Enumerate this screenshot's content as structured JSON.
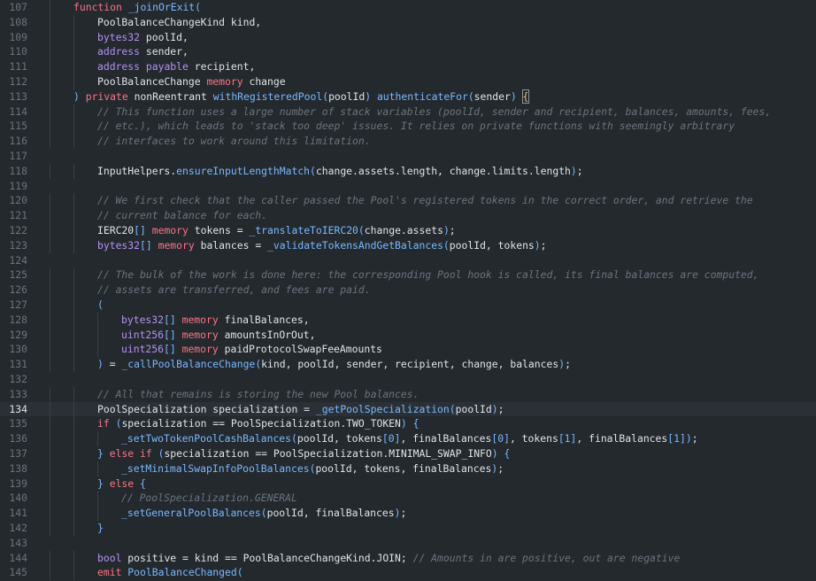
{
  "editor": {
    "current_line": 134,
    "colors": {
      "background": "#24292e",
      "keyword": "#f97583",
      "type": "#b392f0",
      "function": "#79b8ff",
      "comment": "#6a737d",
      "text": "#e1e4e8"
    },
    "lines": [
      {
        "n": 107,
        "indent": 1,
        "parts": [
          [
            "kw",
            "function"
          ],
          [
            "pr",
            " "
          ],
          [
            "fn",
            "_joinOrExit"
          ],
          [
            "pb",
            "("
          ]
        ]
      },
      {
        "n": 108,
        "indent": 2,
        "parts": [
          [
            "ty",
            "PoolBalanceChangeKind"
          ],
          [
            "pr",
            " kind,"
          ]
        ]
      },
      {
        "n": 109,
        "indent": 2,
        "parts": [
          [
            "tk",
            "bytes32"
          ],
          [
            "pr",
            " poolId,"
          ]
        ]
      },
      {
        "n": 110,
        "indent": 2,
        "parts": [
          [
            "tk",
            "address"
          ],
          [
            "pr",
            " sender,"
          ]
        ]
      },
      {
        "n": 111,
        "indent": 2,
        "parts": [
          [
            "tk",
            "address"
          ],
          [
            "pr",
            " "
          ],
          [
            "tk",
            "payable"
          ],
          [
            "pr",
            " recipient,"
          ]
        ]
      },
      {
        "n": 112,
        "indent": 2,
        "parts": [
          [
            "ty",
            "PoolBalanceChange"
          ],
          [
            "pr",
            " "
          ],
          [
            "kw",
            "memory"
          ],
          [
            "pr",
            " change"
          ]
        ]
      },
      {
        "n": 113,
        "indent": 1,
        "parts": [
          [
            "pb",
            ")"
          ],
          [
            "pr",
            " "
          ],
          [
            "kw",
            "private"
          ],
          [
            "pr",
            " nonReentrant "
          ],
          [
            "fnc",
            "withRegisteredPool"
          ],
          [
            "pb",
            "("
          ],
          [
            "pr",
            "poolId"
          ],
          [
            "pb",
            ")"
          ],
          [
            "pr",
            " "
          ],
          [
            "fnc",
            "authenticateFor"
          ],
          [
            "pb",
            "("
          ],
          [
            "pr",
            "sender"
          ],
          [
            "pb",
            ")"
          ],
          [
            "pr",
            " "
          ],
          [
            "bm",
            "{"
          ]
        ]
      },
      {
        "n": 114,
        "indent": 2,
        "parts": [
          [
            "cm",
            "// This function uses a large number of stack variables (poolId, sender and recipient, balances, amounts, fees,"
          ]
        ]
      },
      {
        "n": 115,
        "indent": 2,
        "parts": [
          [
            "cm",
            "// etc.), which leads to 'stack too deep' issues. It relies on private functions with seemingly arbitrary"
          ]
        ]
      },
      {
        "n": 116,
        "indent": 2,
        "parts": [
          [
            "cm",
            "// interfaces to work around this limitation."
          ]
        ]
      },
      {
        "n": 117,
        "indent": 0,
        "parts": []
      },
      {
        "n": 118,
        "indent": 2,
        "parts": [
          [
            "pr",
            "InputHelpers."
          ],
          [
            "fnc",
            "ensureInputLengthMatch"
          ],
          [
            "pb",
            "("
          ],
          [
            "pr",
            "change.assets.length, change.limits.length"
          ],
          [
            "pb",
            ")"
          ],
          [
            "pr",
            ";"
          ]
        ]
      },
      {
        "n": 119,
        "indent": 0,
        "parts": []
      },
      {
        "n": 120,
        "indent": 2,
        "parts": [
          [
            "cm",
            "// We first check that the caller passed the Pool's registered tokens in the correct order, and retrieve the"
          ]
        ]
      },
      {
        "n": 121,
        "indent": 2,
        "parts": [
          [
            "cm",
            "// current balance for each."
          ]
        ]
      },
      {
        "n": 122,
        "indent": 2,
        "parts": [
          [
            "pr",
            "IERC20"
          ],
          [
            "pb",
            "[]"
          ],
          [
            "pr",
            " "
          ],
          [
            "kw",
            "memory"
          ],
          [
            "pr",
            " tokens = "
          ],
          [
            "fnc",
            "_translateToIERC20"
          ],
          [
            "pb",
            "("
          ],
          [
            "pr",
            "change.assets"
          ],
          [
            "pb",
            ")"
          ],
          [
            "pr",
            ";"
          ]
        ]
      },
      {
        "n": 123,
        "indent": 2,
        "parts": [
          [
            "tk",
            "bytes32"
          ],
          [
            "pb",
            "[]"
          ],
          [
            "pr",
            " "
          ],
          [
            "kw",
            "memory"
          ],
          [
            "pr",
            " balances = "
          ],
          [
            "fnc",
            "_validateTokensAndGetBalances"
          ],
          [
            "pb",
            "("
          ],
          [
            "pr",
            "poolId, tokens"
          ],
          [
            "pb",
            ")"
          ],
          [
            "pr",
            ";"
          ]
        ]
      },
      {
        "n": 124,
        "indent": 0,
        "parts": []
      },
      {
        "n": 125,
        "indent": 2,
        "parts": [
          [
            "cm",
            "// The bulk of the work is done here: the corresponding Pool hook is called, its final balances are computed,"
          ]
        ]
      },
      {
        "n": 126,
        "indent": 2,
        "parts": [
          [
            "cm",
            "// assets are transferred, and fees are paid."
          ]
        ]
      },
      {
        "n": 127,
        "indent": 2,
        "parts": [
          [
            "pb",
            "("
          ]
        ]
      },
      {
        "n": 128,
        "indent": 3,
        "parts": [
          [
            "tk",
            "bytes32"
          ],
          [
            "pb",
            "[]"
          ],
          [
            "pr",
            " "
          ],
          [
            "kw",
            "memory"
          ],
          [
            "pr",
            " finalBalances,"
          ]
        ]
      },
      {
        "n": 129,
        "indent": 3,
        "parts": [
          [
            "tk",
            "uint256"
          ],
          [
            "pb",
            "[]"
          ],
          [
            "pr",
            " "
          ],
          [
            "kw",
            "memory"
          ],
          [
            "pr",
            " amountsInOrOut,"
          ]
        ]
      },
      {
        "n": 130,
        "indent": 3,
        "parts": [
          [
            "tk",
            "uint256"
          ],
          [
            "pb",
            "[]"
          ],
          [
            "pr",
            " "
          ],
          [
            "kw",
            "memory"
          ],
          [
            "pr",
            " paidProtocolSwapFeeAmounts"
          ]
        ]
      },
      {
        "n": 131,
        "indent": 2,
        "parts": [
          [
            "pb",
            ")"
          ],
          [
            "pr",
            " = "
          ],
          [
            "fnc",
            "_callPoolBalanceChange"
          ],
          [
            "pb",
            "("
          ],
          [
            "pr",
            "kind, poolId, sender, recipient, change, balances"
          ],
          [
            "pb",
            ")"
          ],
          [
            "pr",
            ";"
          ]
        ]
      },
      {
        "n": 132,
        "indent": 0,
        "parts": []
      },
      {
        "n": 133,
        "indent": 2,
        "parts": [
          [
            "cm",
            "// All that remains is storing the new Pool balances."
          ]
        ]
      },
      {
        "n": 134,
        "indent": 2,
        "parts": [
          [
            "pr",
            "PoolSpecialization specialization = "
          ],
          [
            "fnc",
            "_getPoolSpecialization"
          ],
          [
            "pb",
            "("
          ],
          [
            "pr",
            "poolId"
          ],
          [
            "pb",
            ")"
          ],
          [
            "pr",
            ";"
          ]
        ]
      },
      {
        "n": 135,
        "indent": 2,
        "parts": [
          [
            "kw",
            "if"
          ],
          [
            "pr",
            " "
          ],
          [
            "pb",
            "("
          ],
          [
            "pr",
            "specialization == PoolSpecialization.TWO_TOKEN"
          ],
          [
            "pb",
            ")"
          ],
          [
            "pr",
            " "
          ],
          [
            "pb",
            "{"
          ]
        ]
      },
      {
        "n": 136,
        "indent": 3,
        "parts": [
          [
            "fnc",
            "_setTwoTokenPoolCashBalances"
          ],
          [
            "pb",
            "("
          ],
          [
            "pr",
            "poolId, tokens"
          ],
          [
            "pb",
            "["
          ],
          [
            "num",
            "0"
          ],
          [
            "pb",
            "]"
          ],
          [
            "pr",
            ", finalBalances"
          ],
          [
            "pb",
            "["
          ],
          [
            "num",
            "0"
          ],
          [
            "pb",
            "]"
          ],
          [
            "pr",
            ", tokens"
          ],
          [
            "pb",
            "["
          ],
          [
            "num",
            "1"
          ],
          [
            "pb",
            "]"
          ],
          [
            "pr",
            ", finalBalances"
          ],
          [
            "pb",
            "["
          ],
          [
            "num",
            "1"
          ],
          [
            "pb",
            "]"
          ],
          [
            "pb",
            ")"
          ],
          [
            "pr",
            ";"
          ]
        ]
      },
      {
        "n": 137,
        "indent": 2,
        "parts": [
          [
            "pb",
            "}"
          ],
          [
            "pr",
            " "
          ],
          [
            "kw",
            "else"
          ],
          [
            "pr",
            " "
          ],
          [
            "kw",
            "if"
          ],
          [
            "pr",
            " "
          ],
          [
            "pb",
            "("
          ],
          [
            "pr",
            "specialization == PoolSpecialization.MINIMAL_SWAP_INFO"
          ],
          [
            "pb",
            ")"
          ],
          [
            "pr",
            " "
          ],
          [
            "pb",
            "{"
          ]
        ]
      },
      {
        "n": 138,
        "indent": 3,
        "parts": [
          [
            "fnc",
            "_setMinimalSwapInfoPoolBalances"
          ],
          [
            "pb",
            "("
          ],
          [
            "pr",
            "poolId, tokens, finalBalances"
          ],
          [
            "pb",
            ")"
          ],
          [
            "pr",
            ";"
          ]
        ]
      },
      {
        "n": 139,
        "indent": 2,
        "parts": [
          [
            "pb",
            "}"
          ],
          [
            "pr",
            " "
          ],
          [
            "kw",
            "else"
          ],
          [
            "pr",
            " "
          ],
          [
            "pb",
            "{"
          ]
        ]
      },
      {
        "n": 140,
        "indent": 3,
        "parts": [
          [
            "cm",
            "// PoolSpecialization.GENERAL"
          ]
        ]
      },
      {
        "n": 141,
        "indent": 3,
        "parts": [
          [
            "fnc",
            "_setGeneralPoolBalances"
          ],
          [
            "pb",
            "("
          ],
          [
            "pr",
            "poolId, finalBalances"
          ],
          [
            "pb",
            ")"
          ],
          [
            "pr",
            ";"
          ]
        ]
      },
      {
        "n": 142,
        "indent": 2,
        "parts": [
          [
            "pb",
            "}"
          ]
        ]
      },
      {
        "n": 143,
        "indent": 0,
        "parts": []
      },
      {
        "n": 144,
        "indent": 2,
        "parts": [
          [
            "tk",
            "bool"
          ],
          [
            "pr",
            " positive = kind == PoolBalanceChangeKind.JOIN; "
          ],
          [
            "cm",
            "// Amounts in are positive, out are negative"
          ]
        ]
      },
      {
        "n": 145,
        "indent": 2,
        "parts": [
          [
            "kw",
            "emit"
          ],
          [
            "pr",
            " "
          ],
          [
            "fnc",
            "PoolBalanceChanged"
          ],
          [
            "pb",
            "("
          ]
        ]
      }
    ]
  }
}
